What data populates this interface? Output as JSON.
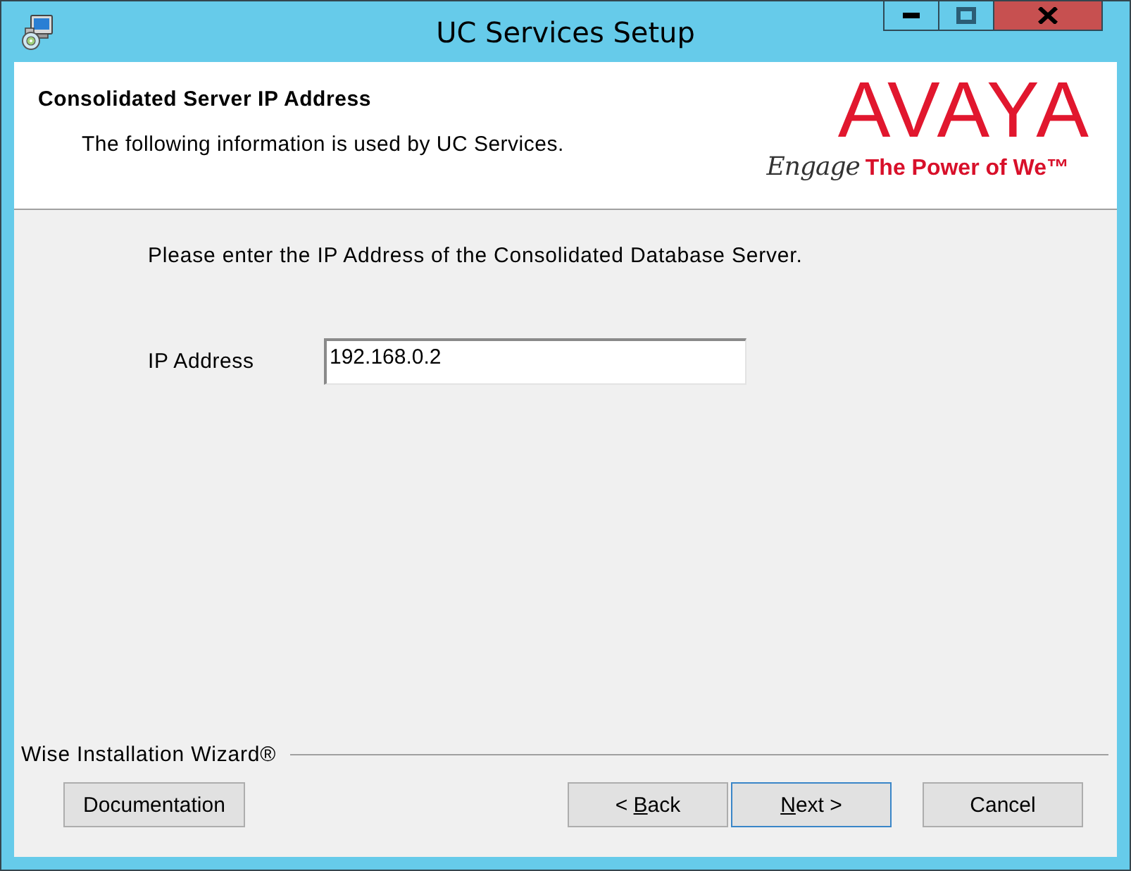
{
  "window": {
    "title": "UC Services Setup"
  },
  "header": {
    "title": "Consolidated Server IP Address",
    "subtitle": "The following information is used by UC Services.",
    "logo": {
      "wordmark": "AVAYA",
      "script": "Engage",
      "tagline": "The Power of We™"
    }
  },
  "body": {
    "instruction": "Please enter the IP Address of the Consolidated Database Server.",
    "fields": [
      {
        "label": "IP Address",
        "value": "192.168.0.2"
      }
    ]
  },
  "footer": {
    "brand": "Wise Installation Wizard®",
    "buttons": [
      {
        "label": "Documentation",
        "focused": false
      },
      {
        "label_start": "< ",
        "access_key": "B",
        "label_end": "ack",
        "focused": false
      },
      {
        "access_key": "N",
        "label_end": "ext >",
        "focused": true
      },
      {
        "label": "Cancel",
        "focused": false
      }
    ]
  }
}
